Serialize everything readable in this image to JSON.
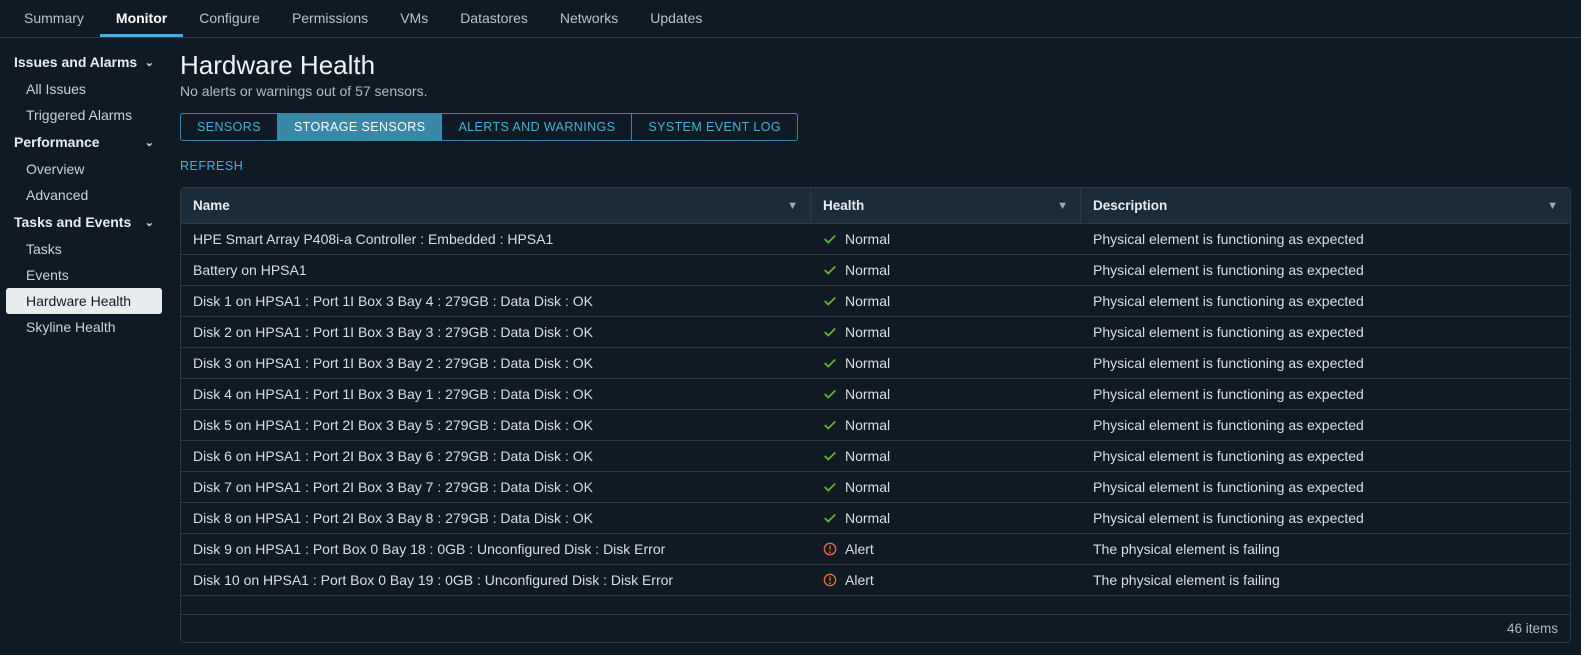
{
  "topnav": [
    {
      "label": "Summary",
      "active": false
    },
    {
      "label": "Monitor",
      "active": true
    },
    {
      "label": "Configure",
      "active": false
    },
    {
      "label": "Permissions",
      "active": false
    },
    {
      "label": "VMs",
      "active": false
    },
    {
      "label": "Datastores",
      "active": false
    },
    {
      "label": "Networks",
      "active": false
    },
    {
      "label": "Updates",
      "active": false
    }
  ],
  "sidebar": [
    {
      "type": "group",
      "label": "Issues and Alarms"
    },
    {
      "type": "item",
      "label": "All Issues",
      "active": false
    },
    {
      "type": "item",
      "label": "Triggered Alarms",
      "active": false
    },
    {
      "type": "group",
      "label": "Performance"
    },
    {
      "type": "item",
      "label": "Overview",
      "active": false
    },
    {
      "type": "item",
      "label": "Advanced",
      "active": false
    },
    {
      "type": "group",
      "label": "Tasks and Events"
    },
    {
      "type": "item",
      "label": "Tasks",
      "active": false
    },
    {
      "type": "item",
      "label": "Events",
      "active": false
    },
    {
      "type": "item",
      "label": "Hardware Health",
      "active": true
    },
    {
      "type": "item",
      "label": "Skyline Health",
      "active": false
    }
  ],
  "page": {
    "title": "Hardware Health",
    "subtitle": "No alerts or warnings out of 57 sensors."
  },
  "subtabs": [
    {
      "label": "SENSORS",
      "active": false
    },
    {
      "label": "STORAGE SENSORS",
      "active": true
    },
    {
      "label": "ALERTS AND WARNINGS",
      "active": false
    },
    {
      "label": "SYSTEM EVENT LOG",
      "active": false
    }
  ],
  "refresh_label": "REFRESH",
  "columns": [
    "Name",
    "Health",
    "Description"
  ],
  "rows": [
    {
      "name": "HPE Smart Array P408i-a Controller : Embedded : HPSA1",
      "health": "Normal",
      "desc": "Physical element is functioning as expected",
      "status": "normal"
    },
    {
      "name": "Battery on HPSA1",
      "health": "Normal",
      "desc": "Physical element is functioning as expected",
      "status": "normal"
    },
    {
      "name": "Disk 1 on HPSA1 : Port 1I Box 3 Bay 4 : 279GB : Data Disk : OK",
      "health": "Normal",
      "desc": "Physical element is functioning as expected",
      "status": "normal"
    },
    {
      "name": "Disk 2 on HPSA1 : Port 1I Box 3 Bay 3 : 279GB : Data Disk : OK",
      "health": "Normal",
      "desc": "Physical element is functioning as expected",
      "status": "normal"
    },
    {
      "name": "Disk 3 on HPSA1 : Port 1I Box 3 Bay 2 : 279GB : Data Disk : OK",
      "health": "Normal",
      "desc": "Physical element is functioning as expected",
      "status": "normal"
    },
    {
      "name": "Disk 4 on HPSA1 : Port 1I Box 3 Bay 1 : 279GB : Data Disk : OK",
      "health": "Normal",
      "desc": "Physical element is functioning as expected",
      "status": "normal"
    },
    {
      "name": "Disk 5 on HPSA1 : Port 2I Box 3 Bay 5 : 279GB : Data Disk : OK",
      "health": "Normal",
      "desc": "Physical element is functioning as expected",
      "status": "normal"
    },
    {
      "name": "Disk 6 on HPSA1 : Port 2I Box 3 Bay 6 : 279GB : Data Disk : OK",
      "health": "Normal",
      "desc": "Physical element is functioning as expected",
      "status": "normal"
    },
    {
      "name": "Disk 7 on HPSA1 : Port 2I Box 3 Bay 7 : 279GB : Data Disk : OK",
      "health": "Normal",
      "desc": "Physical element is functioning as expected",
      "status": "normal"
    },
    {
      "name": "Disk 8 on HPSA1 : Port 2I Box 3 Bay 8 : 279GB : Data Disk : OK",
      "health": "Normal",
      "desc": "Physical element is functioning as expected",
      "status": "normal"
    },
    {
      "name": "Disk 9 on HPSA1 : Port Box 0 Bay 18 : 0GB : Unconfigured Disk : Disk Error",
      "health": "Alert",
      "desc": "The physical element is failing",
      "status": "alert"
    },
    {
      "name": "Disk 10 on HPSA1 : Port Box 0 Bay 19 : 0GB : Unconfigured Disk : Disk Error",
      "health": "Alert",
      "desc": "The physical element is failing",
      "status": "alert"
    }
  ],
  "footer": "46 items"
}
